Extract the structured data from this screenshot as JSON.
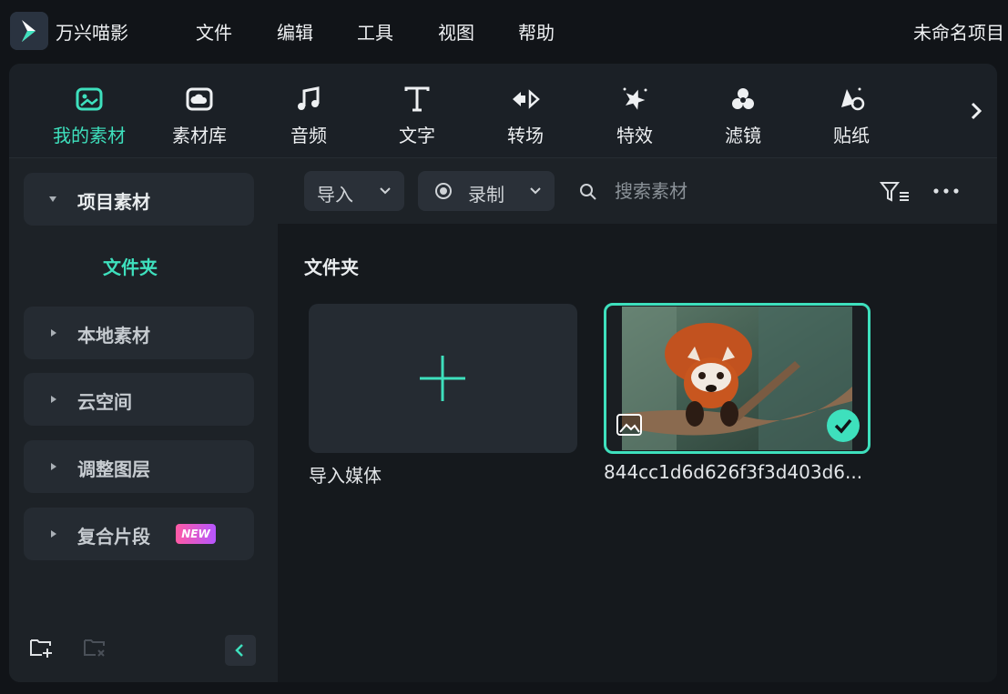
{
  "app": {
    "name": "万兴喵影",
    "project_title": "未命名项目"
  },
  "menu": [
    "文件",
    "编辑",
    "工具",
    "视图",
    "帮助"
  ],
  "toolbar": {
    "tabs": [
      {
        "label": "我的素材",
        "icon": "my-media-icon",
        "active": true
      },
      {
        "label": "素材库",
        "icon": "stock-library-icon",
        "active": false
      },
      {
        "label": "音频",
        "icon": "music-note-icon",
        "active": false
      },
      {
        "label": "文字",
        "icon": "text-icon",
        "active": false
      },
      {
        "label": "转场",
        "icon": "transition-icon",
        "active": false
      },
      {
        "label": "特效",
        "icon": "effects-star-icon",
        "active": false
      },
      {
        "label": "滤镜",
        "icon": "filter-circles-icon",
        "active": false
      },
      {
        "label": "贴纸",
        "icon": "sticker-icon",
        "active": false
      }
    ],
    "accent_color": "#3ee0bd"
  },
  "sidebar": {
    "items": [
      {
        "label": "项目素材",
        "expanded": true
      },
      {
        "label": "本地素材",
        "expanded": false
      },
      {
        "label": "云空间",
        "expanded": false
      },
      {
        "label": "调整图层",
        "expanded": false
      },
      {
        "label": "复合片段",
        "expanded": false,
        "badge": "NEW"
      }
    ],
    "selected_folder": "文件夹"
  },
  "content": {
    "import_label": "导入",
    "record_label": "录制",
    "search_placeholder": "搜索素材",
    "section_title": "文件夹",
    "items": [
      {
        "label": "导入媒体",
        "type": "import"
      },
      {
        "label": "844cc1d6d626f3f3d403d6...",
        "type": "image",
        "selected": true
      }
    ]
  }
}
